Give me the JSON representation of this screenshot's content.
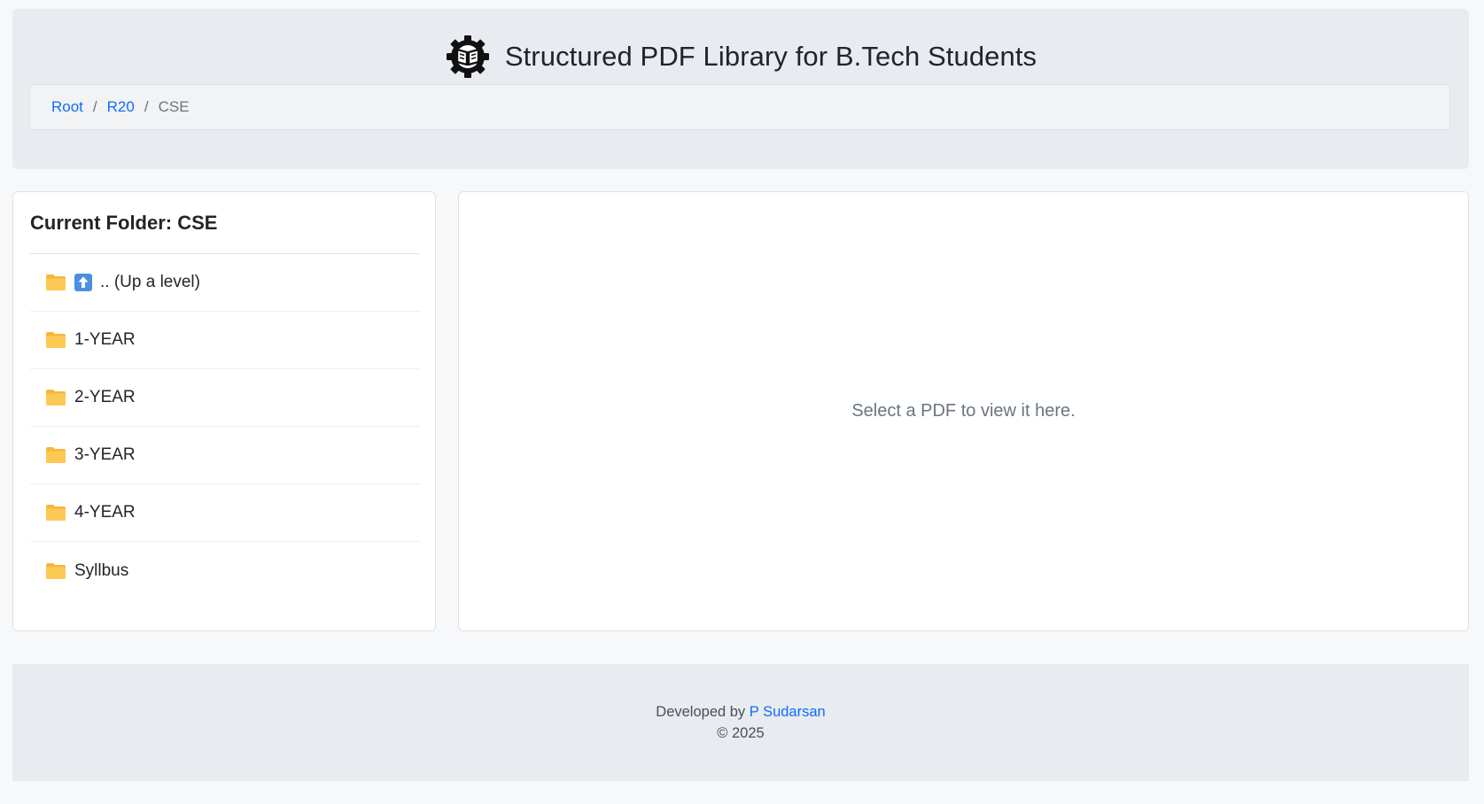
{
  "header": {
    "title": "Structured PDF Library for B.Tech Students",
    "logo_icon": "gear-book-icon"
  },
  "breadcrumb": {
    "items": [
      {
        "label": "Root",
        "link": true
      },
      {
        "label": "R20",
        "link": true
      },
      {
        "label": "CSE",
        "link": false
      }
    ],
    "separator": "/"
  },
  "sidebar": {
    "heading": "Current Folder: CSE",
    "items": [
      {
        "label": ".. (Up a level)",
        "icon": "folder-icon",
        "extra_icon": "up-arrow-icon"
      },
      {
        "label": "1-YEAR",
        "icon": "folder-icon"
      },
      {
        "label": "2-YEAR",
        "icon": "folder-icon"
      },
      {
        "label": "3-YEAR",
        "icon": "folder-icon"
      },
      {
        "label": "4-YEAR",
        "icon": "folder-icon"
      },
      {
        "label": "Syllbus",
        "icon": "folder-icon"
      }
    ]
  },
  "viewer": {
    "placeholder": "Select a PDF to view it here."
  },
  "footer": {
    "developed_by": "Developed by",
    "developer_name": "P Sudarsan",
    "copyright": "© 2025"
  },
  "colors": {
    "link": "#0d6efd",
    "folder": "#fcc24a",
    "up_arrow_bg": "#4a90e2"
  }
}
